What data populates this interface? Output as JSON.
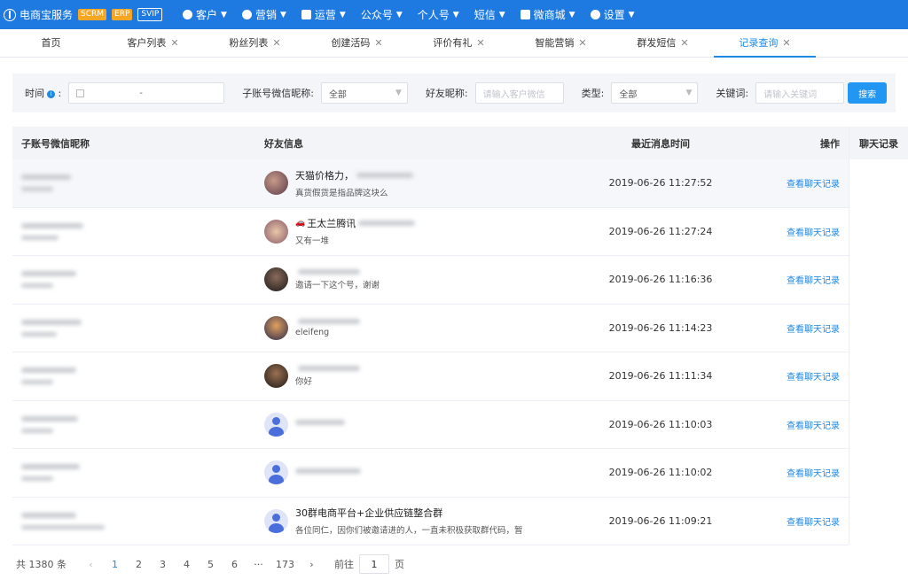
{
  "topbar": {
    "brand_name": "电商宝服务",
    "badges": [
      "SCRM",
      "ERP",
      "SVIP"
    ],
    "menu": [
      {
        "label": "客户",
        "icon": "person-icon",
        "dropdown": true
      },
      {
        "label": "营销",
        "icon": "box-icon",
        "dropdown": true
      },
      {
        "label": "运营",
        "icon": "monitor-icon",
        "dropdown": true
      },
      {
        "label": "公众号",
        "icon": "",
        "dropdown": true
      },
      {
        "label": "个人号",
        "icon": "",
        "dropdown": true
      },
      {
        "label": "短信",
        "icon": "",
        "dropdown": true
      },
      {
        "label": "微商城",
        "icon": "shop-icon",
        "dropdown": true
      },
      {
        "label": "设置",
        "icon": "gear-icon",
        "dropdown": true
      }
    ]
  },
  "tabs": [
    {
      "label": "首页",
      "closable": false
    },
    {
      "label": "客户列表",
      "closable": true
    },
    {
      "label": "粉丝列表",
      "closable": true
    },
    {
      "label": "创建活码",
      "closable": true
    },
    {
      "label": "评价有礼",
      "closable": true
    },
    {
      "label": "智能营销",
      "closable": true
    },
    {
      "label": "群发短信",
      "closable": true
    },
    {
      "label": "记录查询",
      "closable": true,
      "active": true
    }
  ],
  "filter": {
    "time_label": "时间",
    "time_sep": ":",
    "date_dash": "-",
    "sub_account_label": "子账号微信昵称:",
    "sub_account_value": "全部",
    "friend_label": "好友昵称:",
    "friend_placeholder": "请输入客户微信",
    "type_label": "类型:",
    "type_value": "全部",
    "keyword_label": "关键词:",
    "keyword_placeholder": "请输入关键词",
    "search_button": "搜索"
  },
  "table": {
    "headers": [
      "子账号微信昵称",
      "好友信息",
      "最近消息时间",
      "操作"
    ],
    "chat_header": "聊天记录",
    "action_label": "查看聊天记录",
    "rows": [
      {
        "friend_name": "天猫价格力，",
        "friend_msg": "真货假货是指品牌这块么",
        "time": "2019-06-26 11:27:52",
        "avatar": "photo-1"
      },
      {
        "friend_name": "王太兰腾讯",
        "friend_msg": "又有一堆",
        "time": "2019-06-26 11:27:24",
        "avatar": "photo-2"
      },
      {
        "friend_name": "",
        "friend_msg": "邀请一下这个号，谢谢",
        "time": "2019-06-26 11:16:36",
        "avatar": "photo-3"
      },
      {
        "friend_name": "",
        "friend_msg": "eleifeng",
        "time": "2019-06-26 11:14:23",
        "avatar": "photo-4"
      },
      {
        "friend_name": "",
        "friend_msg": "你好",
        "time": "2019-06-26 11:11:34",
        "avatar": "photo-5"
      },
      {
        "friend_name": "",
        "friend_msg": "",
        "time": "2019-06-26 11:10:03",
        "avatar": "default"
      },
      {
        "friend_name": "",
        "friend_msg": "",
        "time": "2019-06-26 11:10:02",
        "avatar": "default"
      },
      {
        "friend_name": "30群电商平台+企业供应链整合群",
        "friend_msg": "各位同仁，因你们被邀请进的人，一直未积极获取群代码，暂",
        "time": "2019-06-26 11:09:21",
        "avatar": "default"
      }
    ]
  },
  "pager": {
    "total": "共 1380 条",
    "prev": "‹",
    "pages": [
      "1",
      "2",
      "3",
      "4",
      "5",
      "6",
      "···",
      "173"
    ],
    "next": "›",
    "goto_label": "前往",
    "goto_value": "1",
    "page_unit": "页"
  },
  "colors": {
    "primary": "#1e7ae0",
    "link": "#1e88e5",
    "badge": "#f5a623"
  }
}
